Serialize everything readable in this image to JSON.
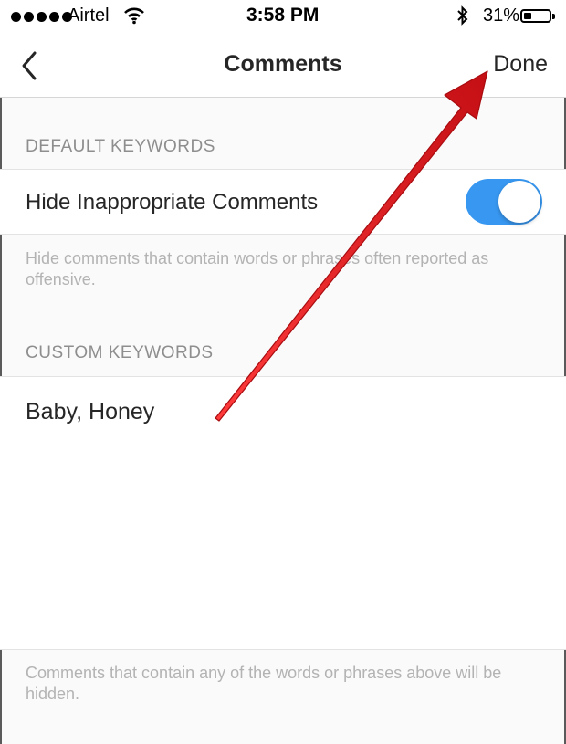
{
  "status_bar": {
    "carrier": "Airtel",
    "time": "3:58 PM",
    "battery_percent": "31%",
    "battery_level": 0.31,
    "icons": [
      "signal-dots-icon",
      "wifi-icon",
      "bluetooth-icon",
      "battery-icon"
    ]
  },
  "nav": {
    "back_icon": "chevron-left-icon",
    "title": "Comments",
    "done_label": "Done"
  },
  "default_keywords": {
    "header": "DEFAULT KEYWORDS",
    "toggle_label": "Hide Inappropriate Comments",
    "toggle_on": true,
    "description": "Hide comments that contain words or phrases often reported as offensive."
  },
  "custom_keywords": {
    "header": "CUSTOM KEYWORDS",
    "value": "Baby, Honey",
    "footer": "Comments that contain any of the words or phrases above will be hidden."
  },
  "colors": {
    "toggle_on": "#3897f0",
    "annotation_arrow": "#e8161b",
    "secondary_text": "#8e8e8e"
  },
  "annotation": {
    "type": "red-arrow",
    "points_to": "done-button"
  }
}
